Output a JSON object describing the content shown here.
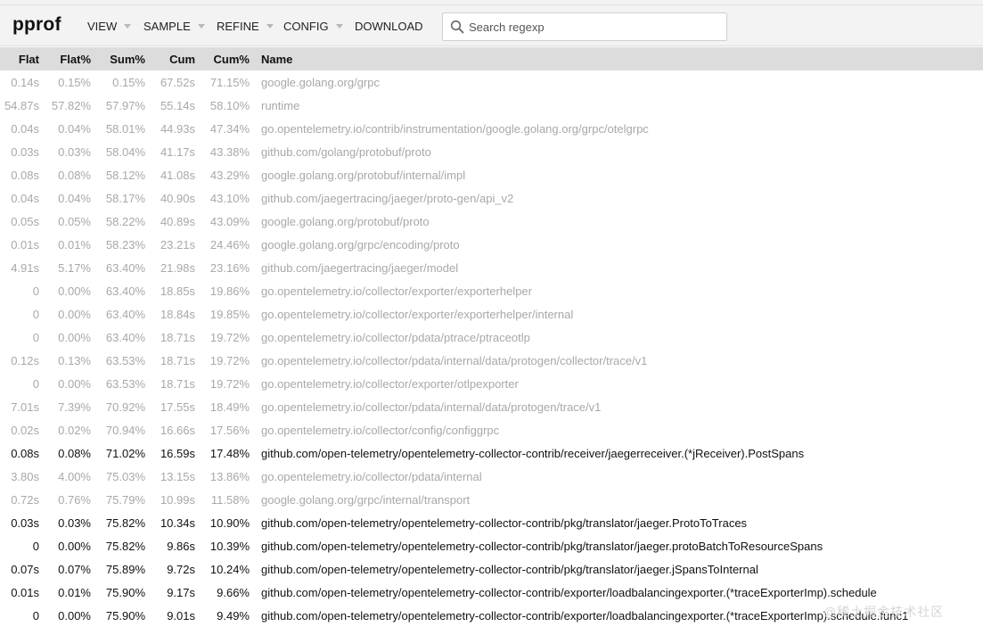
{
  "app": {
    "logo": "pprof"
  },
  "menu": [
    {
      "label": "VIEW",
      "caret": true
    },
    {
      "label": "SAMPLE",
      "caret": true
    },
    {
      "label": "REFINE",
      "caret": true
    },
    {
      "label": "CONFIG",
      "caret": true
    },
    {
      "label": "DOWNLOAD",
      "caret": false
    }
  ],
  "search": {
    "placeholder": "Search regexp",
    "value": "",
    "icon": "search-icon"
  },
  "table": {
    "columns": [
      "Flat",
      "Flat%",
      "Sum%",
      "Cum",
      "Cum%",
      "Name"
    ],
    "rows": [
      {
        "flat": "0.14s",
        "flatp": "0.15%",
        "sump": "0.15%",
        "cum": "67.52s",
        "cump": "71.15%",
        "name": "google.golang.org/grpc",
        "dim": true
      },
      {
        "flat": "54.87s",
        "flatp": "57.82%",
        "sump": "57.97%",
        "cum": "55.14s",
        "cump": "58.10%",
        "name": "runtime",
        "dim": true
      },
      {
        "flat": "0.04s",
        "flatp": "0.04%",
        "sump": "58.01%",
        "cum": "44.93s",
        "cump": "47.34%",
        "name": "go.opentelemetry.io/contrib/instrumentation/google.golang.org/grpc/otelgrpc",
        "dim": true
      },
      {
        "flat": "0.03s",
        "flatp": "0.03%",
        "sump": "58.04%",
        "cum": "41.17s",
        "cump": "43.38%",
        "name": "github.com/golang/protobuf/proto",
        "dim": true
      },
      {
        "flat": "0.08s",
        "flatp": "0.08%",
        "sump": "58.12%",
        "cum": "41.08s",
        "cump": "43.29%",
        "name": "google.golang.org/protobuf/internal/impl",
        "dim": true
      },
      {
        "flat": "0.04s",
        "flatp": "0.04%",
        "sump": "58.17%",
        "cum": "40.90s",
        "cump": "43.10%",
        "name": "github.com/jaegertracing/jaeger/proto-gen/api_v2",
        "dim": true
      },
      {
        "flat": "0.05s",
        "flatp": "0.05%",
        "sump": "58.22%",
        "cum": "40.89s",
        "cump": "43.09%",
        "name": "google.golang.org/protobuf/proto",
        "dim": true
      },
      {
        "flat": "0.01s",
        "flatp": "0.01%",
        "sump": "58.23%",
        "cum": "23.21s",
        "cump": "24.46%",
        "name": "google.golang.org/grpc/encoding/proto",
        "dim": true
      },
      {
        "flat": "4.91s",
        "flatp": "5.17%",
        "sump": "63.40%",
        "cum": "21.98s",
        "cump": "23.16%",
        "name": "github.com/jaegertracing/jaeger/model",
        "dim": true
      },
      {
        "flat": "0",
        "flatp": "0.00%",
        "sump": "63.40%",
        "cum": "18.85s",
        "cump": "19.86%",
        "name": "go.opentelemetry.io/collector/exporter/exporterhelper",
        "dim": true
      },
      {
        "flat": "0",
        "flatp": "0.00%",
        "sump": "63.40%",
        "cum": "18.84s",
        "cump": "19.85%",
        "name": "go.opentelemetry.io/collector/exporter/exporterhelper/internal",
        "dim": true
      },
      {
        "flat": "0",
        "flatp": "0.00%",
        "sump": "63.40%",
        "cum": "18.71s",
        "cump": "19.72%",
        "name": "go.opentelemetry.io/collector/pdata/ptrace/ptraceotlp",
        "dim": true
      },
      {
        "flat": "0.12s",
        "flatp": "0.13%",
        "sump": "63.53%",
        "cum": "18.71s",
        "cump": "19.72%",
        "name": "go.opentelemetry.io/collector/pdata/internal/data/protogen/collector/trace/v1",
        "dim": true
      },
      {
        "flat": "0",
        "flatp": "0.00%",
        "sump": "63.53%",
        "cum": "18.71s",
        "cump": "19.72%",
        "name": "go.opentelemetry.io/collector/exporter/otlpexporter",
        "dim": true
      },
      {
        "flat": "7.01s",
        "flatp": "7.39%",
        "sump": "70.92%",
        "cum": "17.55s",
        "cump": "18.49%",
        "name": "go.opentelemetry.io/collector/pdata/internal/data/protogen/trace/v1",
        "dim": true
      },
      {
        "flat": "0.02s",
        "flatp": "0.02%",
        "sump": "70.94%",
        "cum": "16.66s",
        "cump": "17.56%",
        "name": "go.opentelemetry.io/collector/config/configgrpc",
        "dim": true
      },
      {
        "flat": "0.08s",
        "flatp": "0.08%",
        "sump": "71.02%",
        "cum": "16.59s",
        "cump": "17.48%",
        "name": "github.com/open-telemetry/opentelemetry-collector-contrib/receiver/jaegerreceiver.(*jReceiver).PostSpans",
        "dim": false
      },
      {
        "flat": "3.80s",
        "flatp": "4.00%",
        "sump": "75.03%",
        "cum": "13.15s",
        "cump": "13.86%",
        "name": "go.opentelemetry.io/collector/pdata/internal",
        "dim": true
      },
      {
        "flat": "0.72s",
        "flatp": "0.76%",
        "sump": "75.79%",
        "cum": "10.99s",
        "cump": "11.58%",
        "name": "google.golang.org/grpc/internal/transport",
        "dim": true
      },
      {
        "flat": "0.03s",
        "flatp": "0.03%",
        "sump": "75.82%",
        "cum": "10.34s",
        "cump": "10.90%",
        "name": "github.com/open-telemetry/opentelemetry-collector-contrib/pkg/translator/jaeger.ProtoToTraces",
        "dim": false
      },
      {
        "flat": "0",
        "flatp": "0.00%",
        "sump": "75.82%",
        "cum": "9.86s",
        "cump": "10.39%",
        "name": "github.com/open-telemetry/opentelemetry-collector-contrib/pkg/translator/jaeger.protoBatchToResourceSpans",
        "dim": false
      },
      {
        "flat": "0.07s",
        "flatp": "0.07%",
        "sump": "75.89%",
        "cum": "9.72s",
        "cump": "10.24%",
        "name": "github.com/open-telemetry/opentelemetry-collector-contrib/pkg/translator/jaeger.jSpansToInternal",
        "dim": false
      },
      {
        "flat": "0.01s",
        "flatp": "0.01%",
        "sump": "75.90%",
        "cum": "9.17s",
        "cump": "9.66%",
        "name": "github.com/open-telemetry/opentelemetry-collector-contrib/exporter/loadbalancingexporter.(*traceExporterImp).schedule",
        "dim": false
      },
      {
        "flat": "0",
        "flatp": "0.00%",
        "sump": "75.90%",
        "cum": "9.01s",
        "cump": "9.49%",
        "name": "github.com/open-telemetry/opentelemetry-collector-contrib/exporter/loadbalancingexporter.(*traceExporterImp).schedule.func1",
        "dim": false
      }
    ]
  },
  "watermark": "@稀土掘金技术社区"
}
